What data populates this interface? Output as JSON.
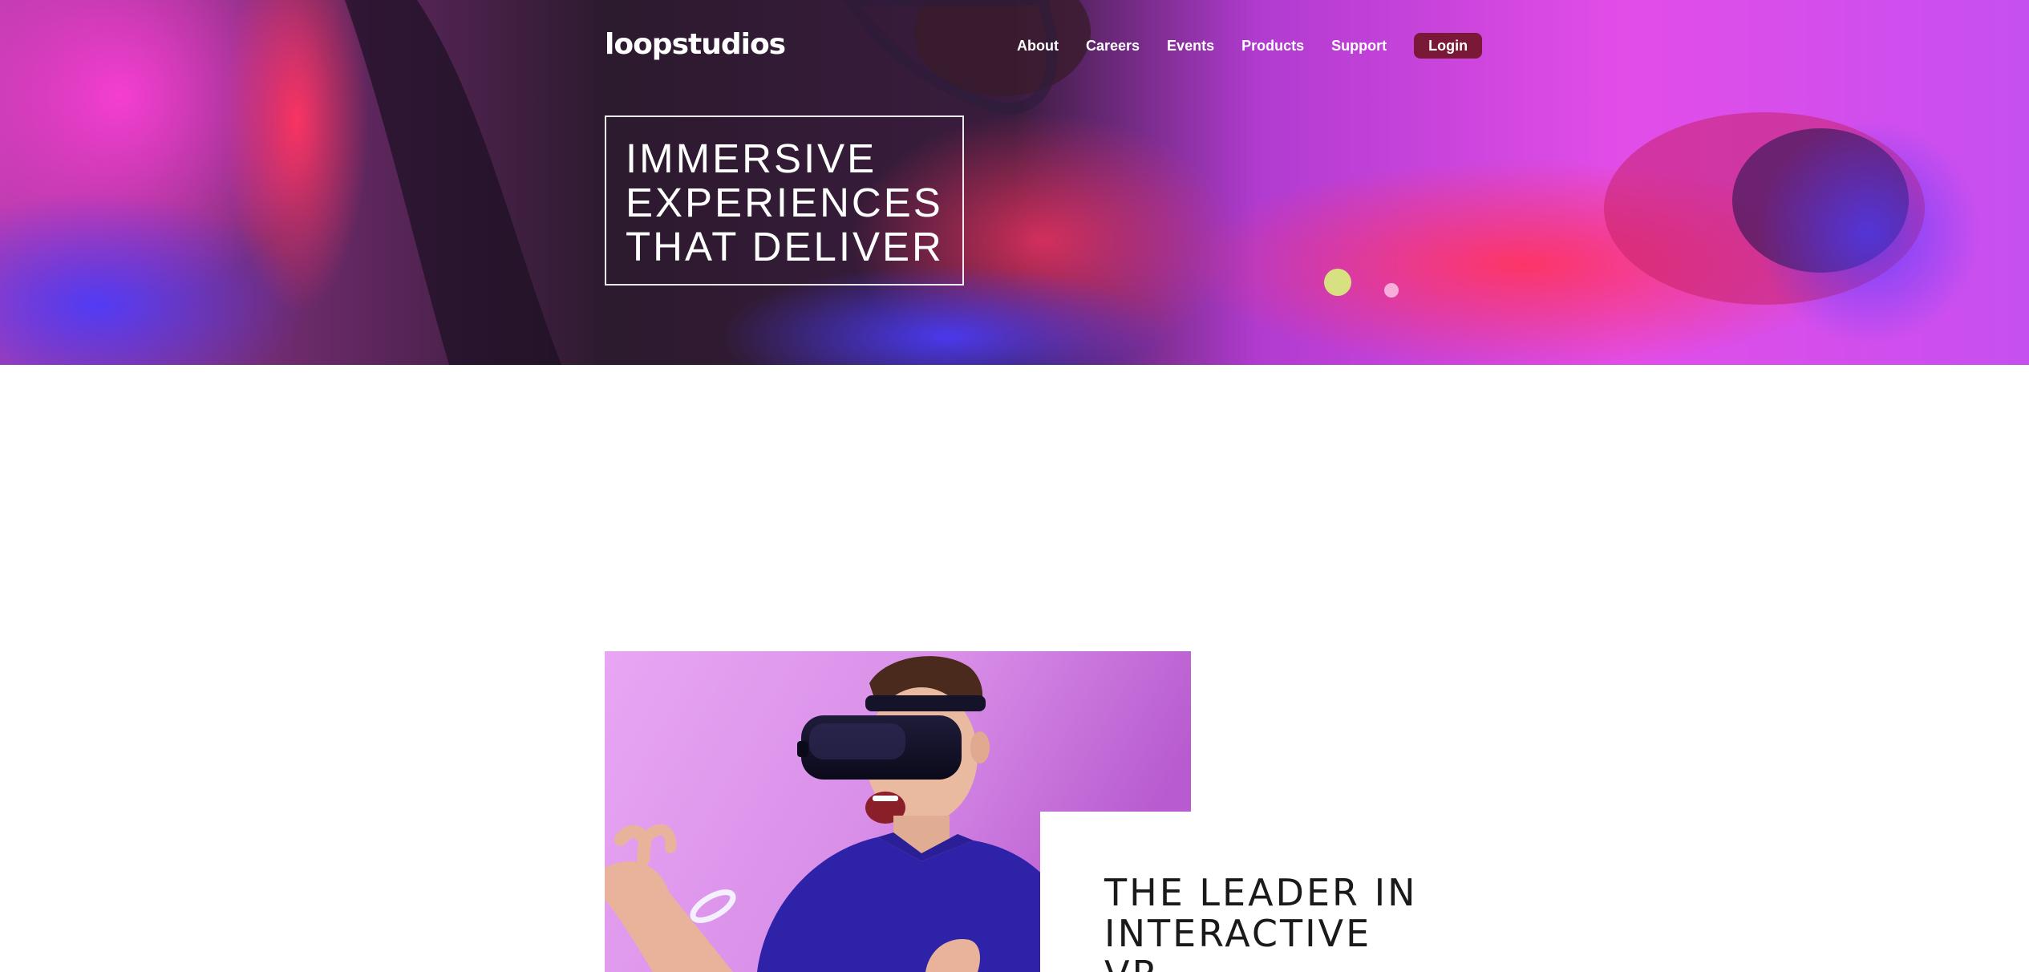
{
  "header": {
    "logo": "loopstudios",
    "nav": [
      {
        "label": "About"
      },
      {
        "label": "Careers"
      },
      {
        "label": "Events"
      },
      {
        "label": "Products"
      },
      {
        "label": "Support"
      }
    ],
    "login_label": "Login"
  },
  "hero": {
    "title_lines": [
      "IMMERSIVE",
      "EXPERIENCES",
      "THAT DELIVER"
    ]
  },
  "interactive": {
    "heading_lines": [
      "THE LEADER IN",
      "INTERACTIVE",
      "VR"
    ]
  },
  "colors": {
    "accent_login": "#7a1838",
    "hero_magenta": "#d63df0",
    "text_dark": "#1a1a1a"
  }
}
